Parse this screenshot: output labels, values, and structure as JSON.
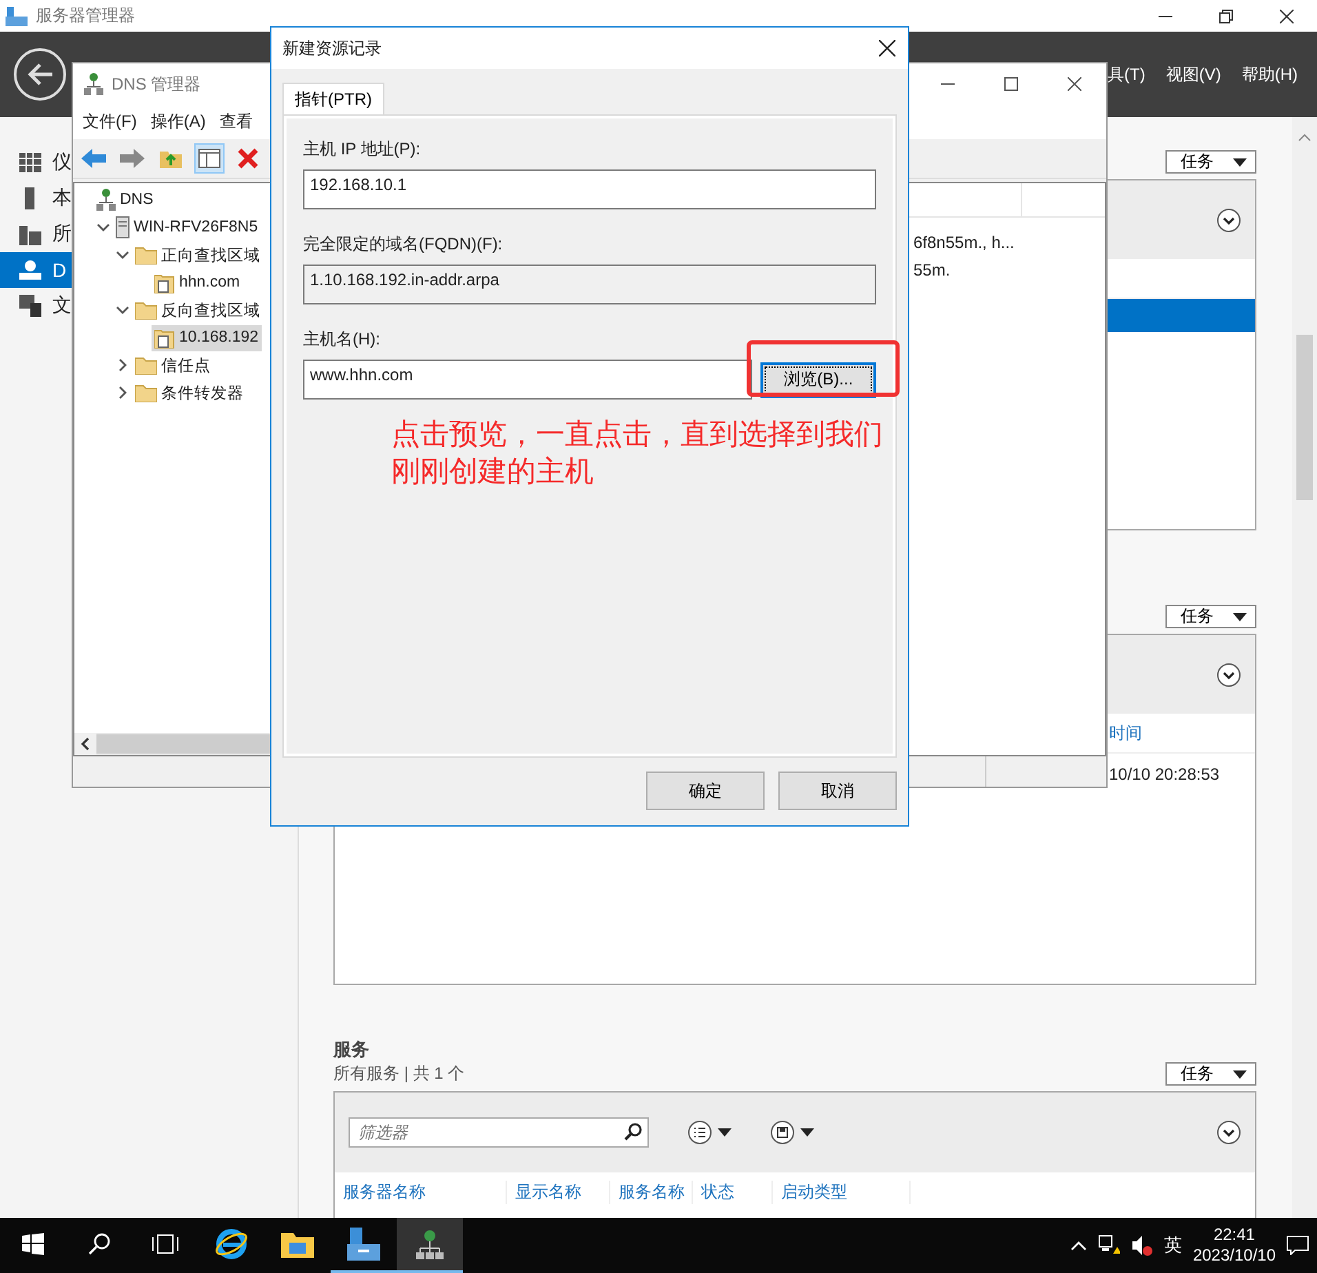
{
  "server_manager": {
    "title": "服务器管理器",
    "menu": [
      "具(T)",
      "视图(V)",
      "帮助(H)"
    ],
    "nav": [
      {
        "label": "仪",
        "kind": "dashboard",
        "selected": false
      },
      {
        "label": "本",
        "kind": "local",
        "selected": false
      },
      {
        "label": "所",
        "kind": "all",
        "selected": false
      },
      {
        "label": "D",
        "kind": "dns",
        "selected": true
      },
      {
        "label": "文",
        "kind": "files",
        "selected": false
      }
    ],
    "events_panel": {
      "task_button": "任务",
      "rows": [
        {
          "selected": true
        }
      ]
    },
    "bpa_panel": {
      "task_button": "任务",
      "column": "时间",
      "cell": "10/10 20:28:53"
    },
    "services": {
      "title": "服务",
      "subtitle": "所有服务 | 共 1 个",
      "task_button": "任务",
      "filter_placeholder": "筛选器",
      "columns": [
        "服务器名称",
        "显示名称",
        "服务名称",
        "状态",
        "启动类型"
      ]
    }
  },
  "dns_manager": {
    "title": "DNS 管理器",
    "menu": [
      "文件(F)",
      "操作(A)",
      "查看"
    ],
    "tree": [
      {
        "label": "DNS",
        "kind": "root",
        "selected": false,
        "children": [
          {
            "label": "WIN-RFV26F8N5",
            "kind": "server",
            "expanded": true,
            "selected": false,
            "children": [
              {
                "label": "正向查找区域",
                "kind": "folder",
                "expanded": true,
                "selected": false,
                "children": [
                  {
                    "label": "hhn.com",
                    "kind": "zone",
                    "selected": false
                  }
                ]
              },
              {
                "label": "反向查找区域",
                "kind": "folder",
                "expanded": true,
                "selected": false,
                "children": [
                  {
                    "label": "10.168.192",
                    "kind": "zone",
                    "selected": true
                  }
                ]
              },
              {
                "label": "信任点",
                "kind": "folder",
                "expanded": false,
                "selected": false
              },
              {
                "label": "条件转发器",
                "kind": "folder",
                "expanded": false,
                "selected": false
              }
            ]
          }
        ]
      }
    ],
    "list": [
      "6f8n55m., h...",
      "55m."
    ]
  },
  "dialog": {
    "title": "新建资源记录",
    "tabs": [
      {
        "label": "指针(PTR)",
        "selected": true
      }
    ],
    "fields": [
      {
        "label": "主机 IP 地址(P):",
        "value": "192.168.10.1",
        "disabled": false
      },
      {
        "label": "完全限定的域名(FQDN)(F):",
        "value": "1.10.168.192.in-addr.arpa",
        "disabled": true
      },
      {
        "label": "主机名(H):",
        "value": "www.hhn.com",
        "disabled": false,
        "browse": "浏览(B)..."
      }
    ],
    "buttons": [
      "确定",
      "取消"
    ]
  },
  "annotation": {
    "text": "点击预览，一直点击，直到选择到我们刚刚创建的主机"
  },
  "taskbar": {
    "apps": [
      {
        "kind": "ie",
        "running": false,
        "selected": false
      },
      {
        "kind": "explorer",
        "running": false,
        "selected": false
      },
      {
        "kind": "server-manager",
        "running": true,
        "selected": false
      },
      {
        "kind": "dns",
        "running": true,
        "selected": true
      }
    ],
    "ime": "英",
    "time": "22:41",
    "date": "2023/10/10"
  }
}
